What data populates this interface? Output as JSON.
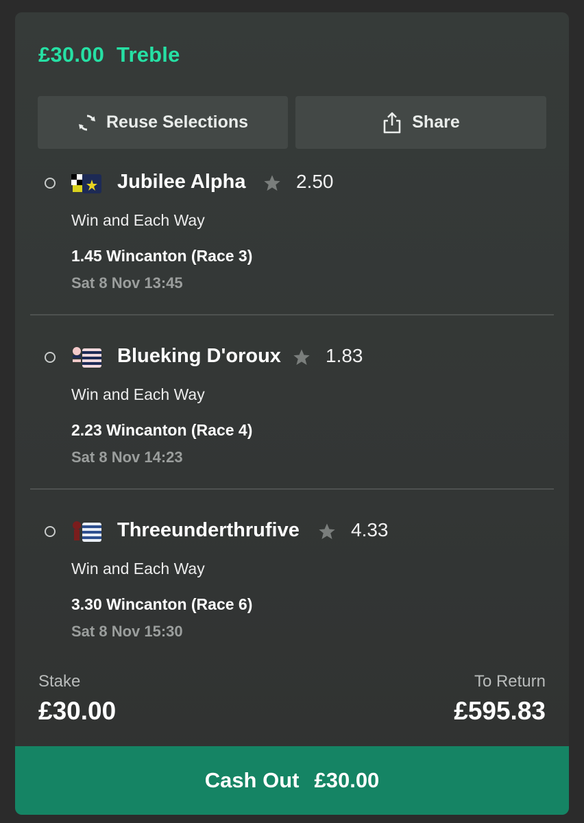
{
  "colors": {
    "accent": "#26e0a4",
    "cashout_bg": "#158464",
    "card_bg": "#353938"
  },
  "bet": {
    "amount": "£30.00",
    "type": "Treble"
  },
  "actions": {
    "reuse_label": "Reuse Selections",
    "share_label": "Share",
    "reuse_icon": "refresh-icon",
    "share_icon": "share-icon"
  },
  "selections": [
    {
      "horse": "Jubilee Alpha",
      "odds": "2.50",
      "market": "Win and Each Way",
      "race": "1.45 Wincanton (Race 3)",
      "when": "Sat 8 Nov 13:45"
    },
    {
      "horse": "Blueking D'oroux",
      "odds": "1.83",
      "market": "Win and Each Way",
      "race": "2.23 Wincanton (Race 4)",
      "when": "Sat 8 Nov 14:23"
    },
    {
      "horse": "Threeunderthrufive",
      "odds": "4.33",
      "market": "Win and Each Way",
      "race": "3.30 Wincanton (Race 6)",
      "when": "Sat 8 Nov 15:30"
    }
  ],
  "summary": {
    "stake_label": "Stake",
    "stake_value": "£30.00",
    "return_label": "To Return",
    "return_value": "£595.83"
  },
  "cashout": {
    "label": "Cash Out",
    "amount": "£30.00"
  }
}
